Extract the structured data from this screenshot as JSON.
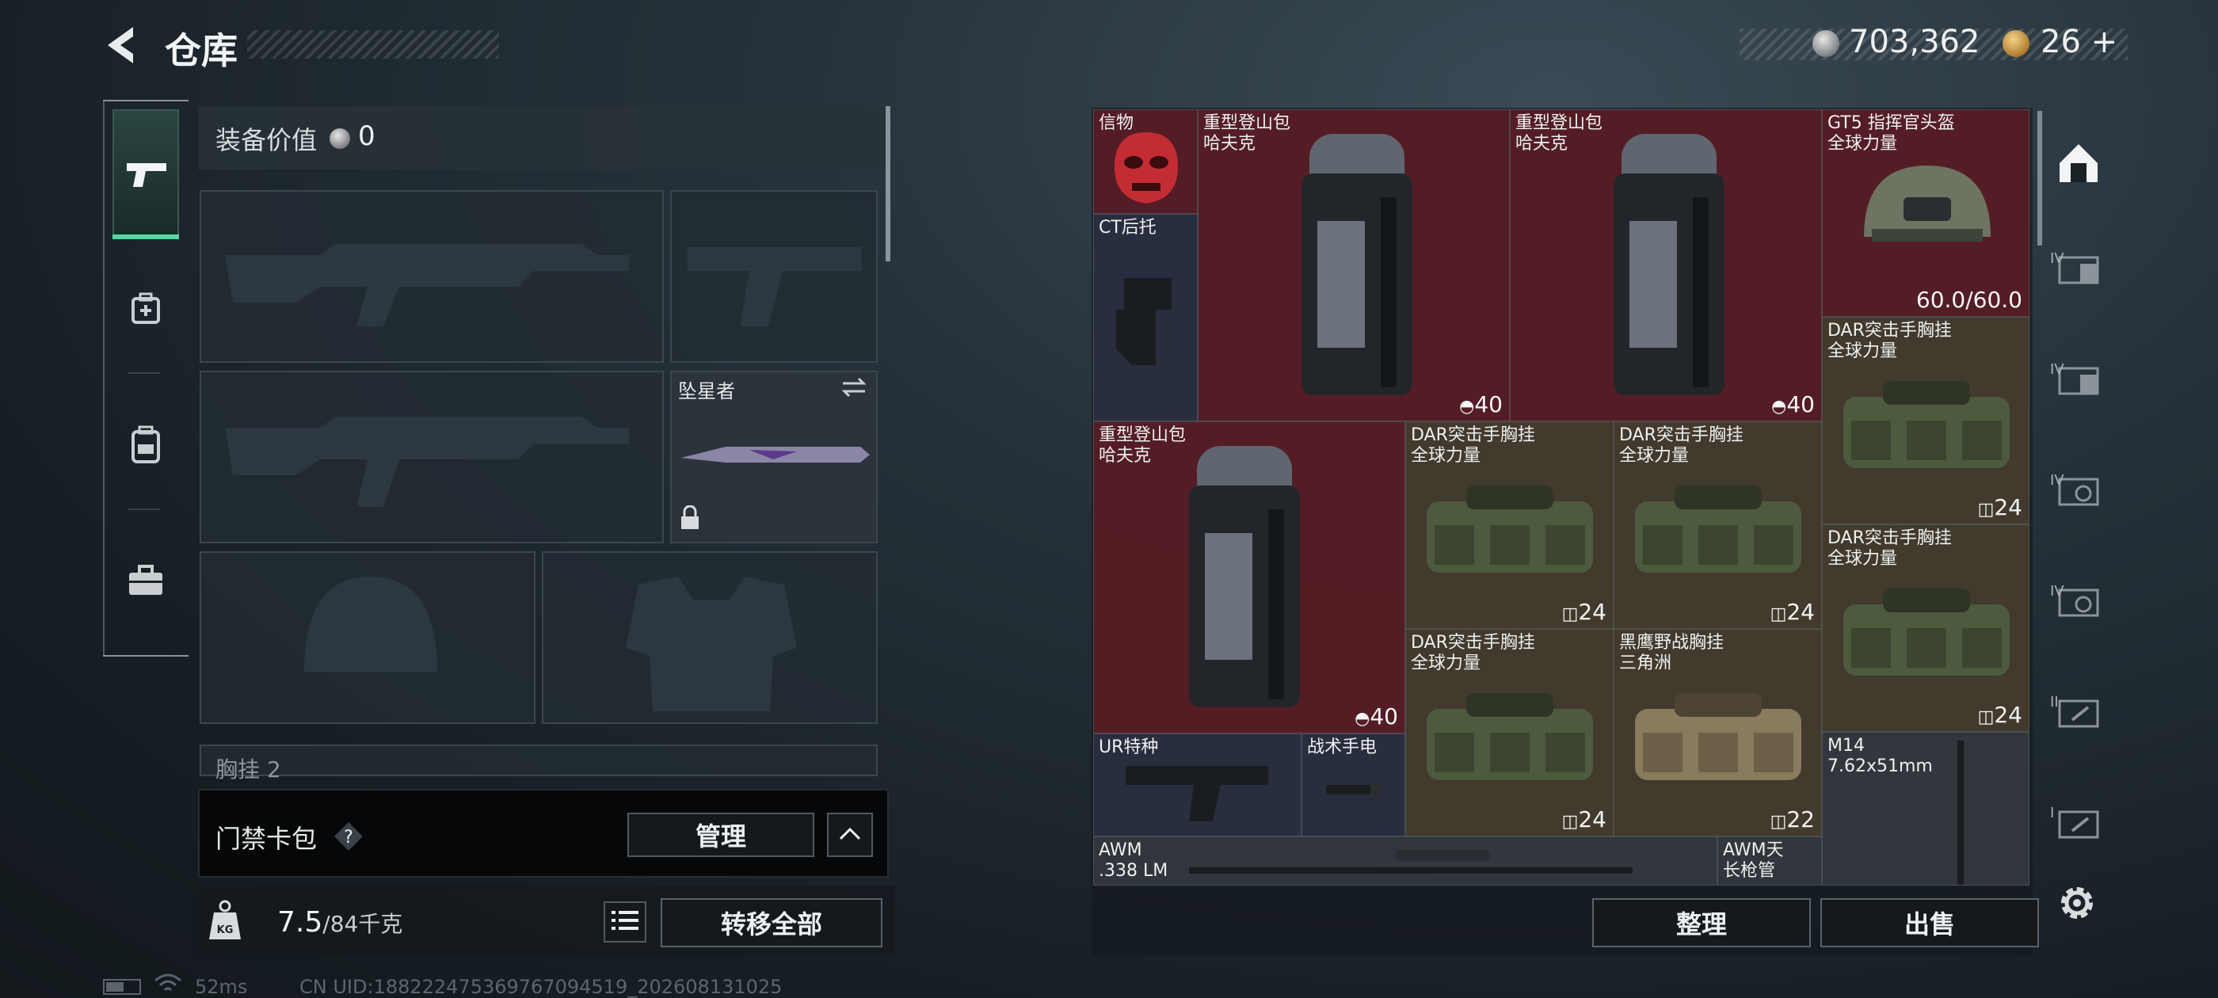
{
  "header": {
    "title": "仓库"
  },
  "currency": {
    "silver": "703,362",
    "gold": "26",
    "gold_add": "+"
  },
  "nav": [
    "gun-icon",
    "medkit-icon",
    "backpack-icon",
    "toolbox-icon"
  ],
  "equipment": {
    "value_label": "装备价值",
    "value": "0",
    "melee_name": "坠星者",
    "chest_label": "胸挂",
    "chest_count": "2"
  },
  "access": {
    "label": "门禁卡包",
    "help": "?",
    "manage": "管理"
  },
  "weight": {
    "value": "7.5",
    "max": "/84千克"
  },
  "buttons": {
    "transfer_all": "转移全部",
    "sort": "整理",
    "sell": "出售"
  },
  "status": {
    "ping": "52ms",
    "uid": "CN UID:18822247536976709451​9_202608131025"
  },
  "stash": {
    "items": [
      {
        "name": "信物",
        "sub": "",
        "count": "",
        "color": "red"
      },
      {
        "name": "重型登山包",
        "sub": "哈夫克",
        "count": "40",
        "color": "red"
      },
      {
        "name": "重型登山包",
        "sub": "哈夫克",
        "count": "40",
        "color": "red"
      },
      {
        "name": "GT5 指挥官头盔",
        "sub": "全球力量",
        "count": "60.0/60.0",
        "color": "red"
      },
      {
        "name": "CT后托",
        "sub": "",
        "count": "",
        "color": "blue"
      },
      {
        "name": "DAR突击手胸挂",
        "sub": "全球力量",
        "count": "24",
        "color": "olive"
      },
      {
        "name": "重型登山包",
        "sub": "哈夫克",
        "count": "40",
        "color": "red"
      },
      {
        "name": "DAR突击手胸挂",
        "sub": "全球力量",
        "count": "24",
        "color": "olive"
      },
      {
        "name": "DAR突击手胸挂",
        "sub": "全球力量",
        "count": "24",
        "color": "olive"
      },
      {
        "name": "DAR突击手胸挂",
        "sub": "全球力量",
        "count": "24",
        "color": "olive"
      },
      {
        "name": "DAR突击手胸挂",
        "sub": "全球力量",
        "count": "24",
        "color": "olive"
      },
      {
        "name": "黑鹰野战胸挂",
        "sub": "三角洲",
        "count": "22",
        "color": "olive"
      },
      {
        "name": "UR特种",
        "sub": "",
        "count": "",
        "color": "blue"
      },
      {
        "name": "战术手电",
        "sub": "",
        "count": "",
        "color": "blue"
      },
      {
        "name": "M14",
        "sub": "7.62x51mm",
        "count": "",
        "color": "gray"
      },
      {
        "name": "AWM",
        "sub": ".338 LM",
        "count": "",
        "color": "gray"
      },
      {
        "name": "AWM天",
        "sub": "长枪管",
        "count": "",
        "color": "gray"
      }
    ]
  },
  "right_tabs": [
    "home-icon",
    "IV",
    "IV",
    "IV",
    "IV",
    "II",
    "I"
  ]
}
